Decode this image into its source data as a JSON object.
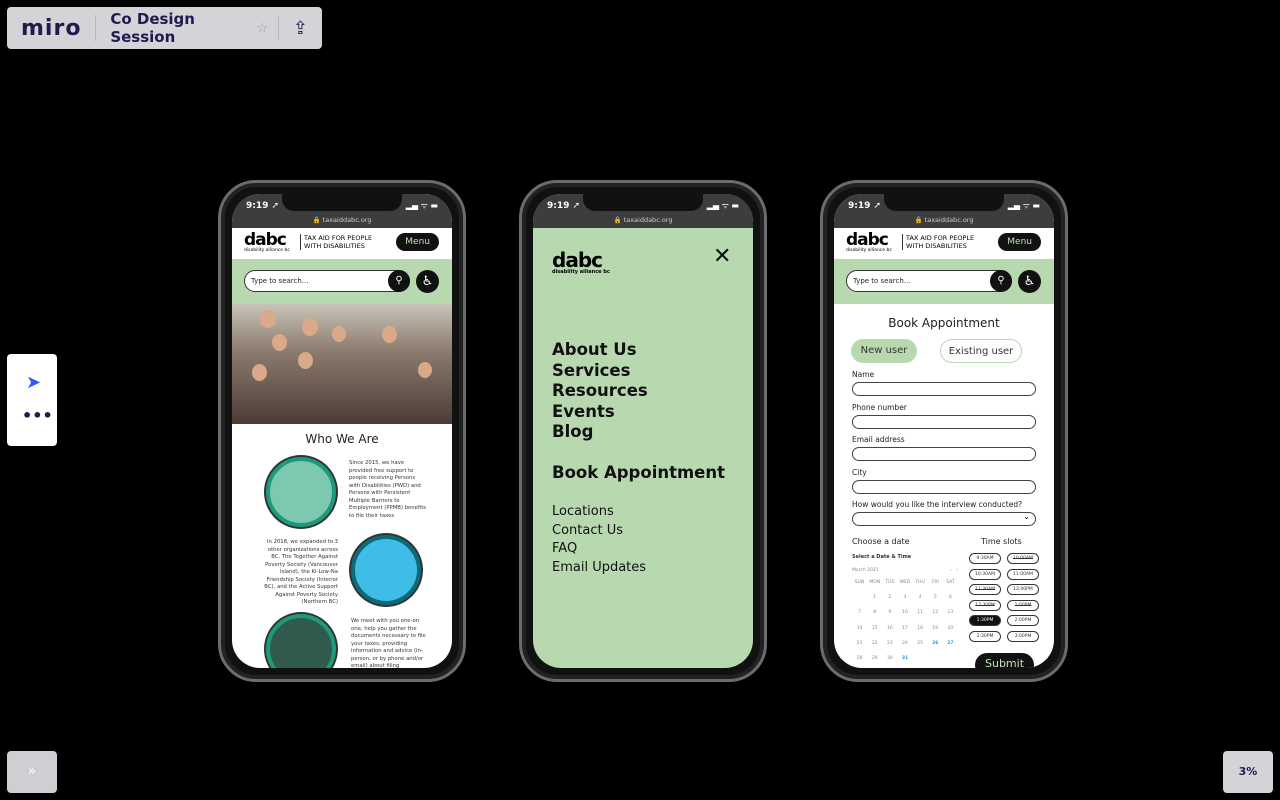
{
  "miro": {
    "logo": "miro",
    "board_title": "Co Design Session",
    "zoom": "3%",
    "expand": "»"
  },
  "phone": {
    "time": "9:19 ➚",
    "indicators": "▂▄ ᯤ ▬",
    "url": "🔒 taxaiddabc.org"
  },
  "site": {
    "logo": "dabc",
    "logo_sub": "disability alliance bc",
    "tagline_1": "TAX AID FOR PEOPLE",
    "tagline_2": "WITH DISABILITIES",
    "menu": "Menu",
    "search_placeholder": "Type to search..."
  },
  "home": {
    "heading": "Who We Are",
    "paragraphs": [
      "Since 2015, we have provided free support to people receiving Persons with Disabilities (PWD) and Persons with Persistent Multiple Barriers to Employment (PPMB) benefits to file their taxes",
      "In 2018, we expanded to 3 other organizations across BC. The Together Against Poverty Society (Vancouver Island), the Ki-Low-Na Friendship Society (Interior BC), and the Active Support Against Poverty Society (Northern BC)",
      "We meet with you one-on one, help you gather the documents necessary to file your taxes, providing information and advice (in-person, or by phone and/or email) about filing"
    ]
  },
  "nav": {
    "primary": [
      "About Us",
      "Services",
      "Resources",
      "Events",
      "Blog"
    ],
    "book": "Book Appointment",
    "secondary": [
      "Locations",
      "Contact Us",
      "FAQ",
      "Email Updates"
    ]
  },
  "booking": {
    "title": "Book Appointment",
    "new_user": "New user",
    "existing_user": "Existing user",
    "fields": [
      "Name",
      "Phone number",
      "Email address",
      "City"
    ],
    "interview_label": "How would you like the interview conducted?",
    "choose_date": "Choose a date",
    "time_slots_label": "Time slots",
    "calendar": {
      "title": "Select a Date & Time",
      "month": "March 2021",
      "days": [
        "SUN",
        "MON",
        "TUE",
        "WED",
        "THU",
        "FRI",
        "SAT"
      ],
      "weeks": [
        [
          "",
          "1",
          "2",
          "3",
          "4",
          "5",
          "6"
        ],
        [
          "7",
          "8",
          "9",
          "10",
          "11",
          "12",
          "13"
        ],
        [
          "14",
          "15",
          "16",
          "17",
          "18",
          "19",
          "20"
        ],
        [
          "21",
          "22",
          "23",
          "24",
          "25",
          "26",
          "27"
        ],
        [
          "28",
          "29",
          "30",
          "31",
          "",
          "",
          ""
        ]
      ],
      "available": [
        "26",
        "27",
        "31"
      ]
    },
    "slots": [
      {
        "t": "9:30AM",
        "s": "open"
      },
      {
        "t": "10:00AM",
        "s": "taken"
      },
      {
        "t": "10:30AM",
        "s": "open"
      },
      {
        "t": "11:00AM",
        "s": "open"
      },
      {
        "t": "11:30AM",
        "s": "taken"
      },
      {
        "t": "12:00PM",
        "s": "open"
      },
      {
        "t": "12:30PM",
        "s": "taken"
      },
      {
        "t": "1:00PM",
        "s": "taken"
      },
      {
        "t": "1:30PM",
        "s": "selected"
      },
      {
        "t": "2:00PM",
        "s": "open"
      },
      {
        "t": "2:30PM",
        "s": "open"
      },
      {
        "t": "3:00PM",
        "s": "open"
      }
    ],
    "submit": "Submit"
  },
  "colors": {
    "brand_green": "#b8d8b0",
    "miro_navy": "#1e1c4f",
    "teal": "#1d9a7a"
  }
}
